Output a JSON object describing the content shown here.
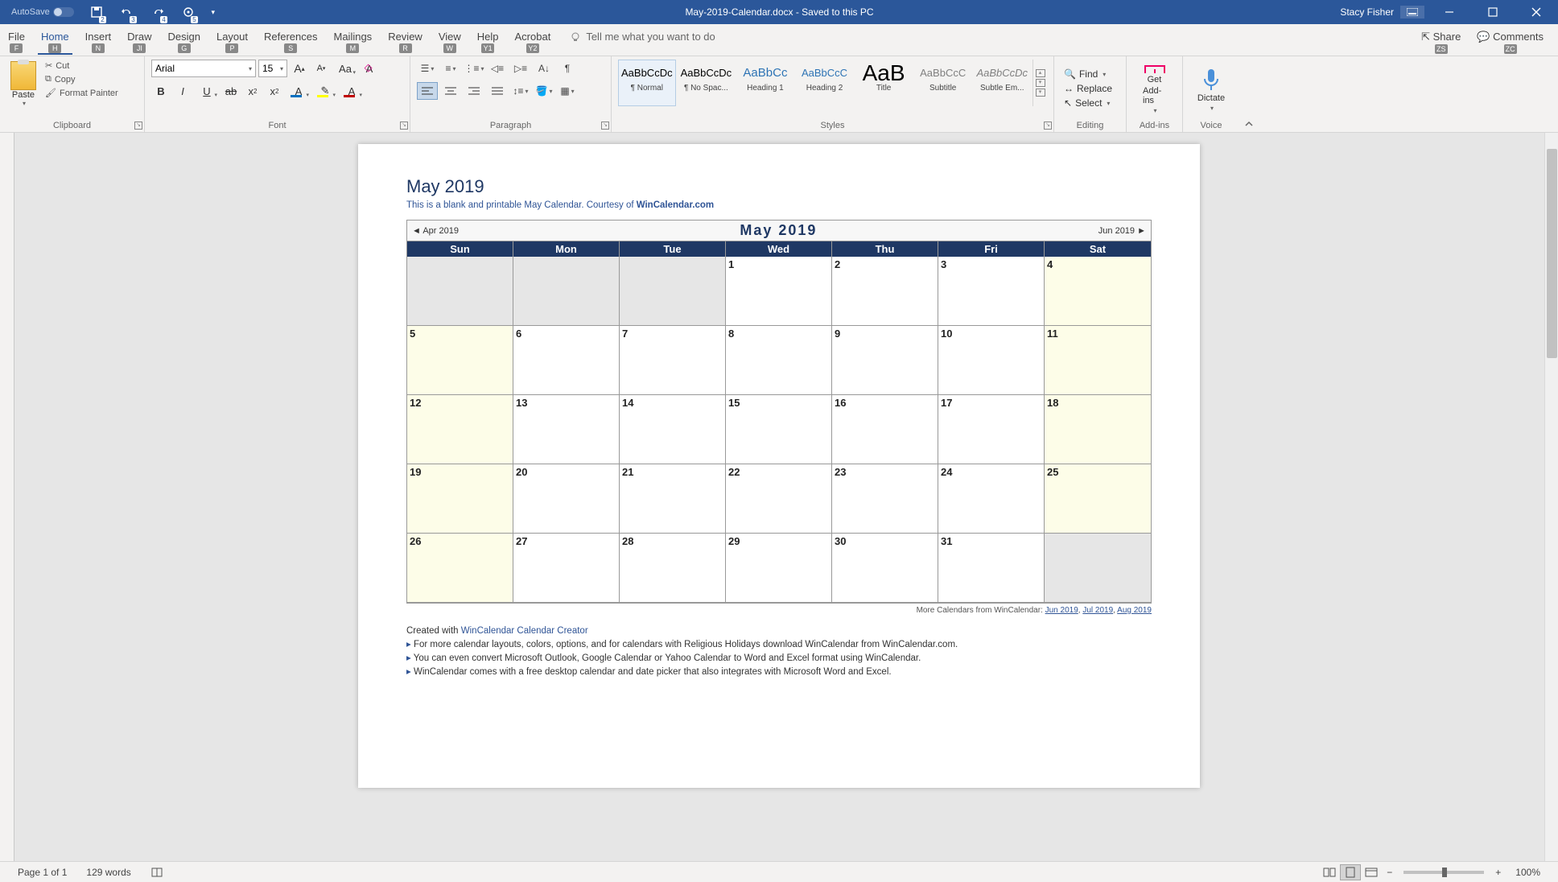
{
  "titlebar": {
    "autosave": "AutoSave",
    "doc_title": "May-2019-Calendar.docx  -  Saved to this PC",
    "user": "Stacy Fisher",
    "qat_keys": [
      "2",
      "3",
      "4",
      "5"
    ]
  },
  "tabs": {
    "file": "File",
    "home": "Home",
    "insert": "Insert",
    "draw": "Draw",
    "design": "Design",
    "layout": "Layout",
    "references": "References",
    "mailings": "Mailings",
    "review": "Review",
    "view": "View",
    "help": "Help",
    "acrobat": "Acrobat",
    "tellme": "Tell me what you want to do",
    "share": "Share",
    "comments": "Comments",
    "keys": {
      "file": "F",
      "home": "H",
      "insert": "N",
      "draw": "JI",
      "design": "G",
      "layout": "P",
      "references": "S",
      "mailings": "M",
      "review": "R",
      "view": "W",
      "help": "Y1",
      "acrobat": "Y2",
      "share": "ZS",
      "comments": "ZC"
    }
  },
  "ribbon": {
    "clipboard": {
      "label": "Clipboard",
      "paste": "Paste",
      "cut": "Cut",
      "copy": "Copy",
      "format_painter": "Format Painter"
    },
    "font": {
      "label": "Font",
      "name": "Arial",
      "size": "15"
    },
    "paragraph": {
      "label": "Paragraph"
    },
    "styles": {
      "label": "Styles",
      "items": [
        {
          "preview": "AaBbCcDc",
          "name": "¶ Normal",
          "color": "#000"
        },
        {
          "preview": "AaBbCcDc",
          "name": "¶ No Spac...",
          "color": "#000"
        },
        {
          "preview": "AaBbCc",
          "name": "Heading 1",
          "color": "#2e74b5",
          "size": "15px"
        },
        {
          "preview": "AaBbCcC",
          "name": "Heading 2",
          "color": "#2e74b5",
          "size": "13px"
        },
        {
          "preview": "AaB",
          "name": "Title",
          "color": "#000",
          "size": "28px"
        },
        {
          "preview": "AaBbCcC",
          "name": "Subtitle",
          "color": "#808080"
        },
        {
          "preview": "AaBbCcDc",
          "name": "Subtle Em...",
          "color": "#808080",
          "style": "italic"
        }
      ]
    },
    "editing": {
      "label": "Editing",
      "find": "Find",
      "replace": "Replace",
      "select": "Select"
    },
    "addins": {
      "label": "Add-ins",
      "get": "Get",
      "sub": "Add-ins"
    },
    "voice": {
      "label": "Voice",
      "dictate": "Dictate"
    }
  },
  "doc": {
    "title": "May 2019",
    "subtitle_pre": "This is a blank and printable May Calendar.  Courtesy of ",
    "subtitle_link": "WinCalendar.com",
    "prev": "Apr 2019",
    "next": "Jun 2019",
    "header": "May   2019",
    "days": [
      "Sun",
      "Mon",
      "Tue",
      "Wed",
      "Thu",
      "Fri",
      "Sat"
    ],
    "cells": [
      [
        "",
        "",
        "",
        "1",
        "2",
        "3",
        "4"
      ],
      [
        "5",
        "6",
        "7",
        "8",
        "9",
        "10",
        "11"
      ],
      [
        "12",
        "13",
        "14",
        "15",
        "16",
        "17",
        "18"
      ],
      [
        "19",
        "20",
        "21",
        "22",
        "23",
        "24",
        "25"
      ],
      [
        "26",
        "27",
        "28",
        "29",
        "30",
        "31",
        ""
      ]
    ],
    "more_pre": "More Calendars from WinCalendar: ",
    "more_links": [
      "Jun 2019",
      "Jul 2019",
      "Aug 2019"
    ],
    "footer_created_pre": "Created with ",
    "footer_created_link": "WinCalendar Calendar Creator",
    "bullets": [
      "For more calendar layouts, colors, options, and for calendars with Religious Holidays download WinCalendar from WinCalendar.com.",
      "You can even convert Microsoft Outlook, Google Calendar or Yahoo Calendar to Word and Excel format using WinCalendar.",
      "WinCalendar comes with a free desktop calendar and date picker that also integrates with Microsoft Word and Excel."
    ]
  },
  "status": {
    "page": "Page 1 of 1",
    "words": "129 words",
    "zoom": "100%"
  }
}
